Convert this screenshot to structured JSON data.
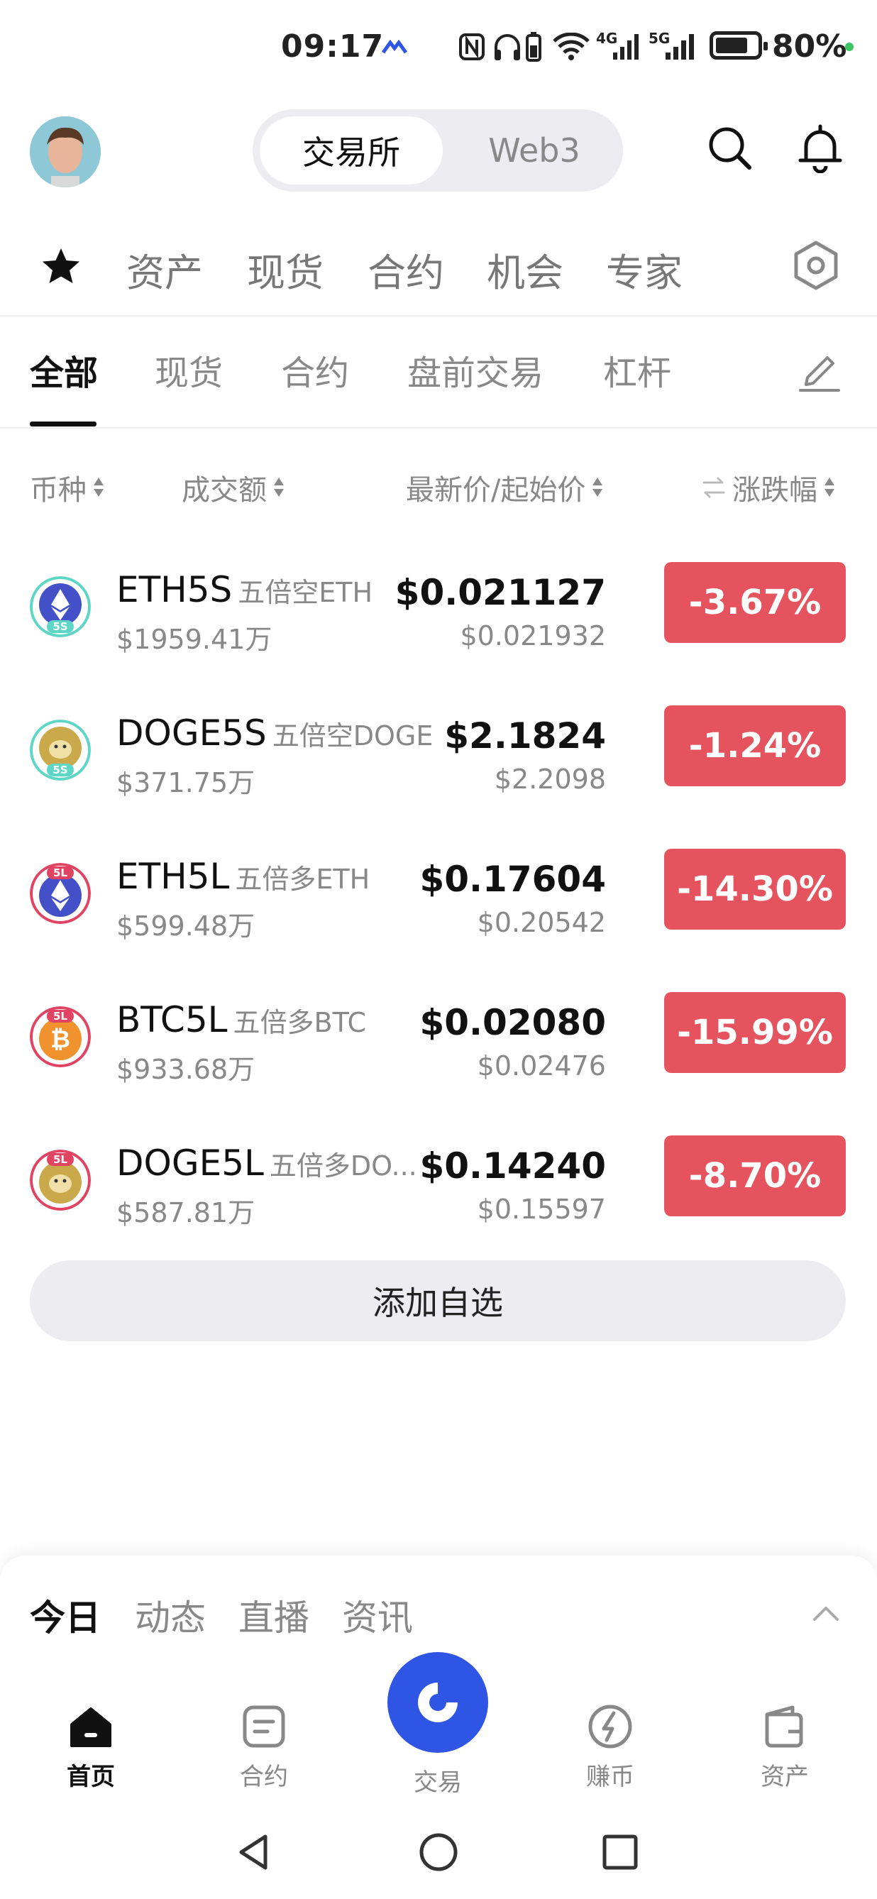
{
  "status_bar": {
    "time": "09:17",
    "signal_4g": "4G",
    "signal_5g": "5G",
    "battery_pct": "80%"
  },
  "header": {
    "segment_active": "交易所",
    "segment_inactive": "Web3"
  },
  "primary_nav": {
    "items": [
      "资产",
      "现货",
      "合约",
      "机会",
      "专家"
    ]
  },
  "secondary_tabs": {
    "items": [
      "全部",
      "现货",
      "合约",
      "盘前交易",
      "杠杆"
    ],
    "active_index": 0
  },
  "columns": {
    "coin": "币种",
    "volume": "成交额",
    "price": "最新价/起始价",
    "change": "涨跌幅"
  },
  "rows": [
    {
      "symbol": "ETH5S",
      "desc": "五倍空ETH",
      "volume": "$1959.41万",
      "price": "$0.021127",
      "open": "$0.021932",
      "change": "-3.67%",
      "badge": "5S",
      "coin": "eth"
    },
    {
      "symbol": "DOGE5S",
      "desc": "五倍空DOGE",
      "volume": "$371.75万",
      "price": "$2.1824",
      "open": "$2.2098",
      "change": "-1.24%",
      "badge": "5S",
      "coin": "doge"
    },
    {
      "symbol": "ETH5L",
      "desc": "五倍多ETH",
      "volume": "$599.48万",
      "price": "$0.17604",
      "open": "$0.20542",
      "change": "-14.30%",
      "badge": "5L",
      "coin": "eth"
    },
    {
      "symbol": "BTC5L",
      "desc": "五倍多BTC",
      "volume": "$933.68万",
      "price": "$0.02080",
      "open": "$0.02476",
      "change": "-15.99%",
      "badge": "5L",
      "coin": "btc"
    },
    {
      "symbol": "DOGE5L",
      "desc": "五倍多DO...",
      "volume": "$587.81万",
      "price": "$0.14240",
      "open": "$0.15597",
      "change": "-8.70%",
      "badge": "5L",
      "coin": "doge"
    }
  ],
  "add_favorite_label": "添加自选",
  "panel_tabs": [
    "今日",
    "动态",
    "直播",
    "资讯"
  ],
  "tab_bar": {
    "home": "首页",
    "futures": "合约",
    "trade": "交易",
    "earn": "赚币",
    "assets": "资产"
  },
  "colors": {
    "down": "#e5535e",
    "accent": "#2f55e4",
    "short_badge": "#5ed6c6",
    "long_badge": "#e04462"
  }
}
